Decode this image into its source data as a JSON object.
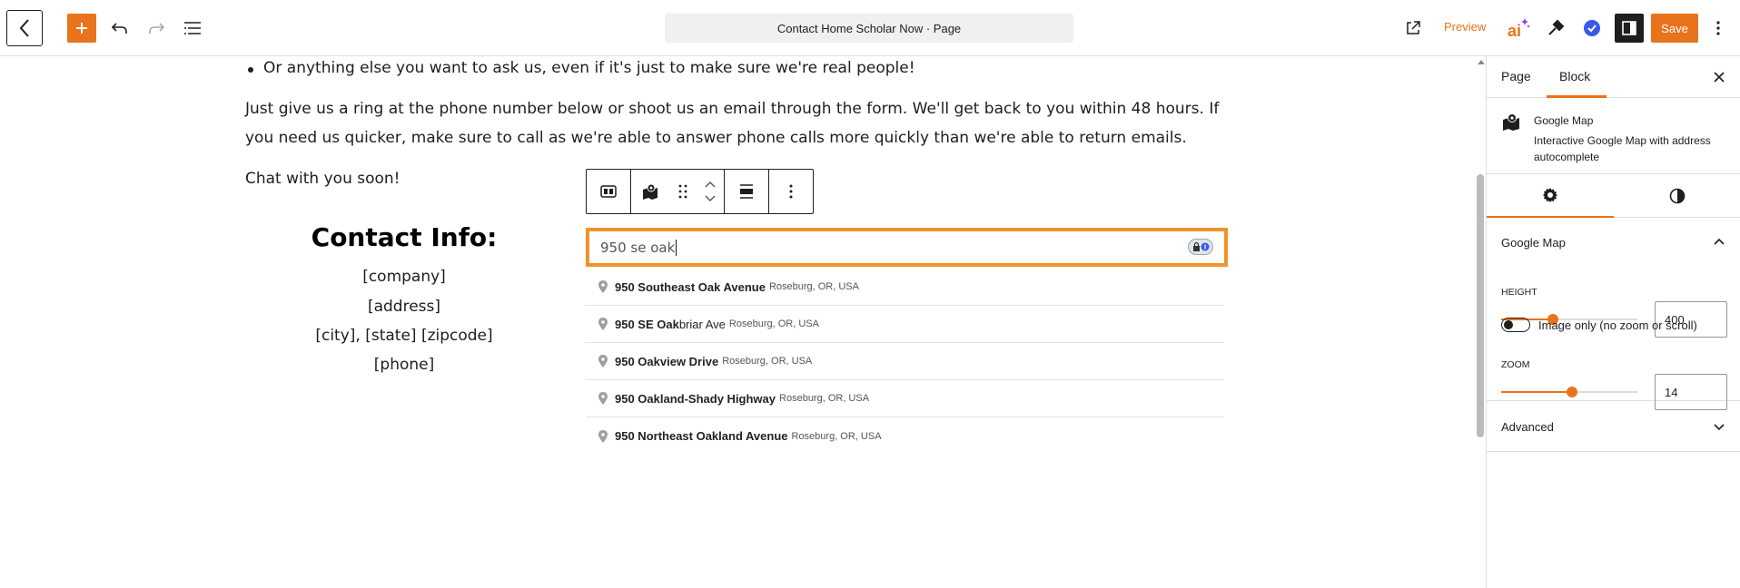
{
  "topbar": {
    "title": "Contact Home Scholar Now · Page",
    "preview_label": "Preview",
    "save_label": "Save",
    "ai_label": "ai",
    "colors": {
      "accent": "#e8731c",
      "check": "#3858e9"
    }
  },
  "content": {
    "bullet": "Or anything else you want to ask us, even if it's just to make sure we're real people!",
    "paragraph": "Just give us a ring at the phone number below or shoot us an email through the form. We'll get back to you within 48 hours. If you need us quicker, make sure to call as we're able to answer phone calls more quickly than we're able to return emails.",
    "chat": "Chat with you soon!",
    "contact_title": "Contact Info:",
    "contact_lines": [
      "[company]",
      "[address]",
      "[city], [state] [zipcode]",
      "[phone]"
    ]
  },
  "map_block": {
    "input_value": "950 se oak",
    "suggestions": [
      {
        "main_bold": "950 Southeast Oak Avenue",
        "main_rest": "",
        "secondary": "Roseburg, OR, USA"
      },
      {
        "main_bold": "950 SE Oak",
        "main_rest": "briar Ave",
        "secondary": "Roseburg, OR, USA"
      },
      {
        "main_bold": "950 Oakview Drive",
        "main_rest": "",
        "secondary": "Roseburg, OR, USA"
      },
      {
        "main_bold": "950 Oakland-Shady Highway",
        "main_rest": "",
        "secondary": "Roseburg, OR, USA"
      },
      {
        "main_bold": "950 Northeast Oakland Avenue",
        "main_rest": "",
        "secondary": "Roseburg, OR, USA"
      }
    ]
  },
  "sidebar": {
    "tabs": {
      "page": "Page",
      "block": "Block"
    },
    "block_name": "Google Map",
    "block_desc": "Interactive Google Map with address autocomplete",
    "panel_title": "Google Map",
    "height": {
      "label": "HEIGHT",
      "value": "400",
      "fraction": 0.38
    },
    "zoom": {
      "label": "ZOOM",
      "value": "14",
      "fraction": 0.52
    },
    "image_only_label": "Image only (no zoom or scroll)",
    "image_only_on": false,
    "advanced_label": "Advanced"
  }
}
